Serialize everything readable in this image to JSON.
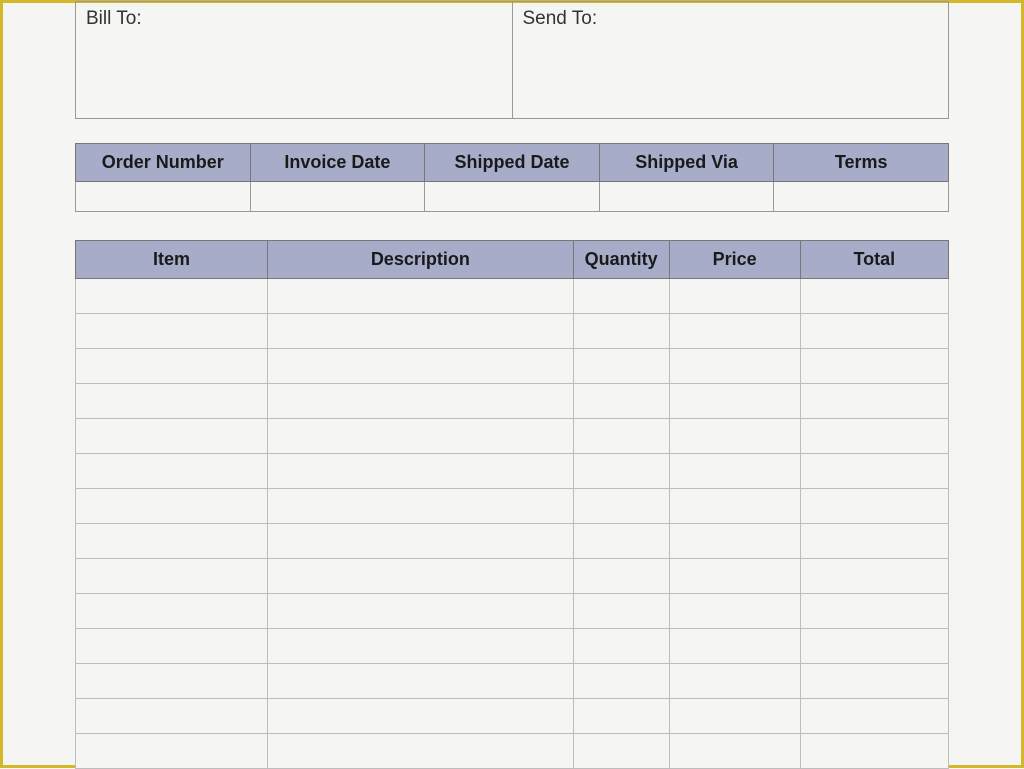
{
  "address": {
    "bill_to_label": "Bill To:",
    "send_to_label": "Send To:"
  },
  "order_headers": {
    "order_number": "Order Number",
    "invoice_date": "Invoice Date",
    "shipped_date": "Shipped Date",
    "shipped_via": "Shipped Via",
    "terms": "Terms"
  },
  "item_headers": {
    "item": "Item",
    "description": "Description",
    "quantity": "Quantity",
    "price": "Price",
    "total": "Total"
  },
  "line_item_count": 14
}
